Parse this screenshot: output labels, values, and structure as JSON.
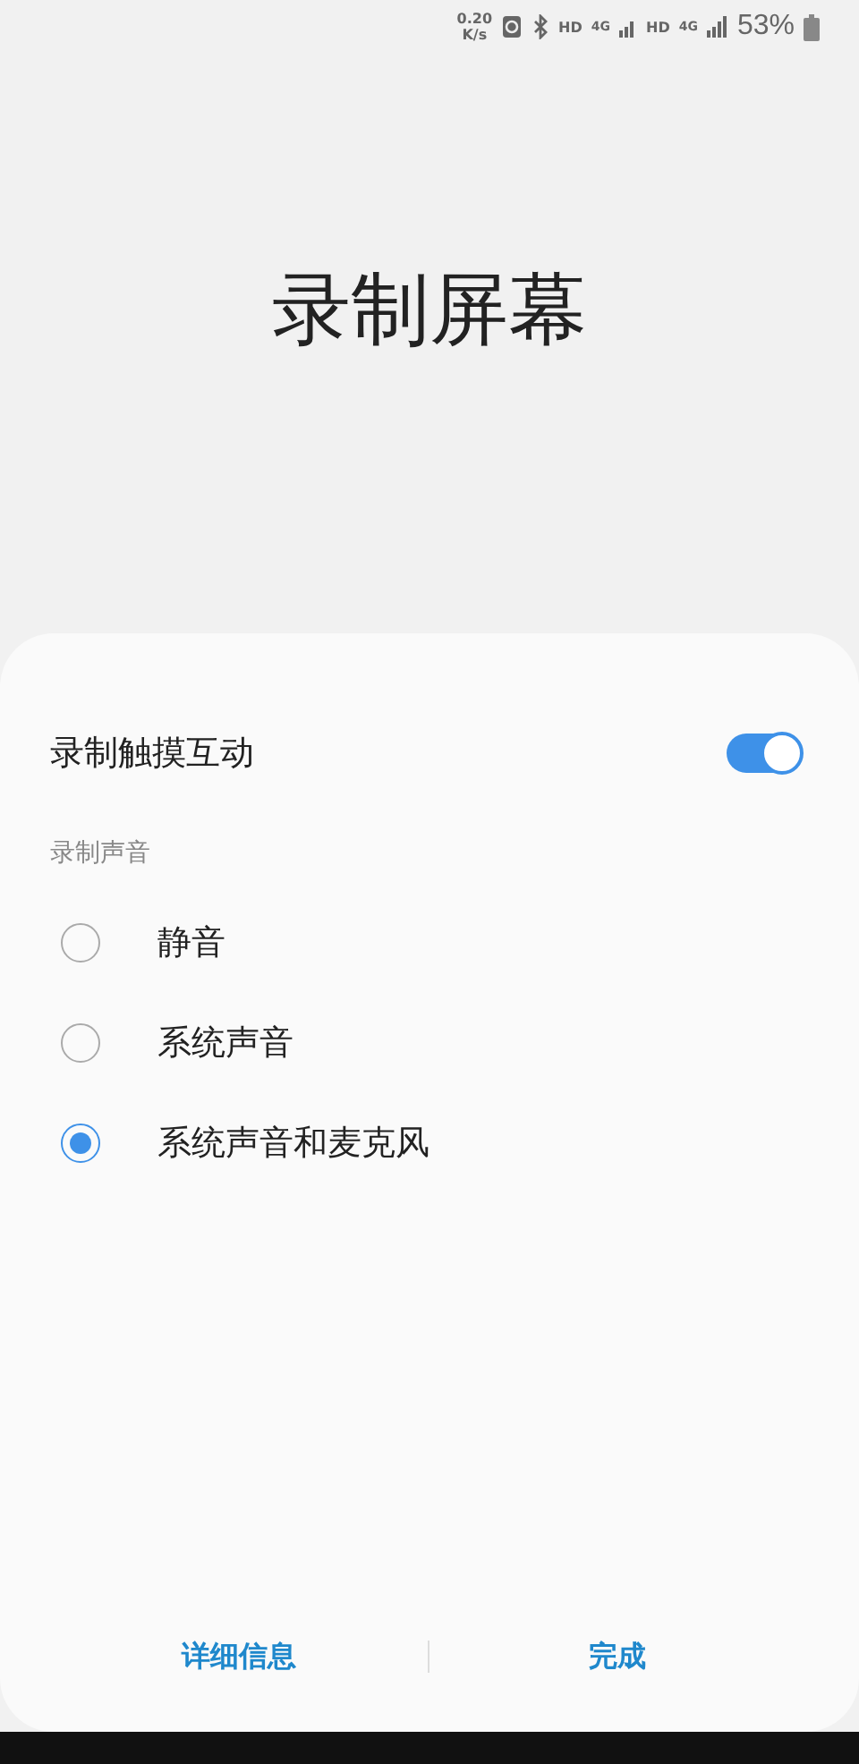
{
  "status_bar": {
    "net_speed_value": "0.20",
    "net_speed_unit": "K/s",
    "sim1_hd": "HD",
    "sim1_network": "4G",
    "sim2_hd": "HD",
    "sim2_network": "4G",
    "battery": "53%"
  },
  "title": "录制屏幕",
  "toggle": {
    "label": "录制触摸互动",
    "on": true
  },
  "sound_section": {
    "label": "录制声音",
    "options": [
      {
        "label": "静音",
        "selected": false
      },
      {
        "label": "系统声音",
        "selected": false
      },
      {
        "label": "系统声音和麦克风",
        "selected": true
      }
    ]
  },
  "buttons": [
    {
      "label": "详细信息"
    },
    {
      "label": "完成"
    }
  ]
}
